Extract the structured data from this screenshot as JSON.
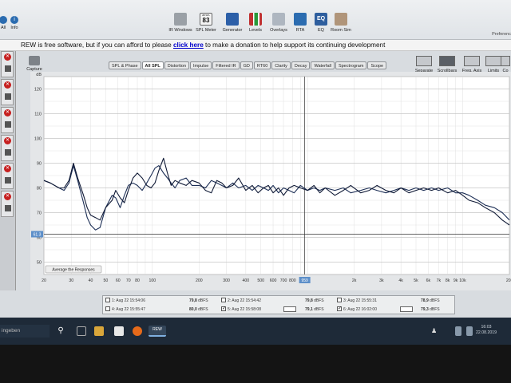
{
  "app": {
    "banner_text": "REW is free software, but if you can afford to please ",
    "banner_link": "click here",
    "banner_tail": " to make a donation to help support its continuing development"
  },
  "toolbar": {
    "left_items": [
      "All",
      "Info"
    ],
    "buttons": [
      {
        "label": "IR Windows",
        "icon": "ir-windows-icon",
        "color": "#8a8f95"
      },
      {
        "label": "SPL Meter",
        "icon": "spl-meter-icon",
        "value": "83",
        "unit": "dB SPL",
        "color": "#4a4f56"
      },
      {
        "label": "Generator",
        "icon": "generator-icon",
        "color": "#2c5fa8"
      },
      {
        "label": "Levels",
        "icon": "levels-icon",
        "color": "#c03030"
      },
      {
        "label": "Overlays",
        "icon": "overlays-icon",
        "color": "#7b8794"
      },
      {
        "label": "RTA",
        "icon": "rta-icon",
        "color": "#2b6cb0"
      },
      {
        "label": "EQ",
        "icon": "eq-icon",
        "color": "#2e5e9e"
      },
      {
        "label": "Room Sim",
        "icon": "room-sim-icon",
        "color": "#8a6f55"
      }
    ],
    "preferences_label": "Preferenc"
  },
  "capture_label": "Capture",
  "tabs": [
    "SPL & Phase",
    "All SPL",
    "Distortion",
    "Impulse",
    "Filtered IR",
    "GD",
    "RT60",
    "Clarity",
    "Decay",
    "Waterfall",
    "Spectrogram",
    "Scope"
  ],
  "active_tab": "All SPL",
  "right_controls": [
    "Separate",
    "Scrollbars",
    "Freq. Axis",
    "Limits",
    "Co"
  ],
  "graph": {
    "ylabel": "dB",
    "cursor_y_label": "61.3",
    "cursor_x_label": "959",
    "average_button": "Average the Responses"
  },
  "chart_data": {
    "type": "line",
    "xscale": "log",
    "xlim": [
      20,
      20000
    ],
    "ylim": [
      45,
      125
    ],
    "yticks": [
      50,
      60,
      70,
      80,
      90,
      100,
      110,
      120
    ],
    "xtick_labels": [
      "20",
      "30",
      "40",
      "50",
      "60",
      "70",
      "80",
      "100",
      "200",
      "300",
      "400",
      "500",
      "600",
      "700",
      "800",
      "1k",
      "2k",
      "3k",
      "4k",
      "5k",
      "6k",
      "7k",
      "8k",
      "9k",
      "10k",
      "20k"
    ],
    "xtick_values": [
      20,
      30,
      40,
      50,
      60,
      70,
      80,
      100,
      200,
      300,
      400,
      500,
      600,
      700,
      800,
      1000,
      2000,
      3000,
      4000,
      5000,
      6000,
      7000,
      8000,
      9000,
      10000,
      20000
    ],
    "cursor": {
      "x": 959,
      "y": 61.3
    },
    "grid": true,
    "series": [
      {
        "x": [
          20,
          22,
          25,
          27,
          29,
          31,
          33,
          36,
          38,
          40,
          43,
          46,
          50,
          55,
          58,
          62,
          66,
          70,
          75,
          80,
          86,
          92,
          98,
          104,
          110,
          118,
          125,
          132,
          140,
          150,
          165,
          180,
          200,
          220,
          240,
          260,
          280,
          300,
          330,
          360,
          400,
          440,
          480,
          520,
          560,
          600,
          650,
          700,
          760,
          820,
          900,
          1000,
          1100,
          1200,
          1300,
          1500,
          1700,
          1900,
          2200,
          2500,
          2800,
          3200,
          3600,
          4000,
          4500,
          5000,
          5600,
          6300,
          7000,
          8000,
          9000,
          10000,
          11000,
          12500,
          14000,
          16000,
          18000,
          20000
        ],
        "y": [
          83,
          82,
          80,
          79,
          82,
          89,
          83,
          74,
          68,
          65,
          63,
          64,
          72,
          77,
          76,
          72,
          77,
          81,
          82,
          81,
          79,
          82,
          85,
          88,
          89,
          86,
          84,
          82,
          80,
          83,
          84,
          81,
          81,
          80,
          83,
          82,
          81,
          80,
          82,
          80,
          81,
          79,
          81,
          80,
          79,
          81,
          78,
          80,
          79,
          78,
          81,
          79,
          80,
          79,
          80,
          79,
          80,
          78,
          79,
          80,
          79,
          78,
          79,
          80,
          79,
          80,
          79,
          80,
          79,
          80,
          78,
          78,
          77,
          75,
          73,
          72,
          70,
          67
        ]
      },
      {
        "x": [
          20,
          22,
          25,
          27,
          29,
          31,
          33,
          36,
          38,
          40,
          43,
          46,
          50,
          55,
          58,
          62,
          66,
          70,
          75,
          80,
          86,
          92,
          98,
          104,
          110,
          118,
          125,
          132,
          140,
          150,
          165,
          180,
          200,
          220,
          240,
          260,
          280,
          300,
          330,
          360,
          400,
          440,
          480,
          520,
          560,
          600,
          650,
          700,
          760,
          820,
          900,
          1000,
          1100,
          1200,
          1300,
          1500,
          1700,
          1900,
          2200,
          2500,
          2800,
          3200,
          3600,
          4000,
          4500,
          5000,
          5600,
          6300,
          7000,
          8000,
          9000,
          10000,
          11000,
          12500,
          14000,
          16000,
          18000,
          20000
        ],
        "y": [
          83,
          82,
          80,
          80,
          83,
          90,
          84,
          77,
          72,
          69,
          68,
          67,
          72,
          75,
          79,
          76,
          74,
          79,
          84,
          86,
          84,
          81,
          80,
          82,
          87,
          92,
          86,
          81,
          83,
          82,
          81,
          83,
          82,
          79,
          78,
          83,
          82,
          80,
          81,
          84,
          79,
          81,
          78,
          80,
          81,
          78,
          80,
          77,
          80,
          81,
          80,
          79,
          81,
          78,
          80,
          77,
          79,
          81,
          78,
          79,
          81,
          79,
          78,
          80,
          78,
          79,
          80,
          79,
          80,
          78,
          79,
          77,
          75,
          74,
          72,
          70,
          67,
          65
        ]
      }
    ]
  },
  "legend": {
    "entries": [
      {
        "label": "1: Aug 22 15:54:06",
        "value": "79,8",
        "unit": "dBFS",
        "checked": false
      },
      {
        "label": "2: Aug 22 15:54:42",
        "value": "79,8",
        "unit": "dBFS",
        "checked": false
      },
      {
        "label": "3: Aug 22 15:55:31",
        "value": "78,9",
        "unit": "dBFS",
        "checked": false
      },
      {
        "label": "4: Aug 22 15:55:47",
        "value": "80,0",
        "unit": "dBFS",
        "checked": false
      },
      {
        "label": "5: Aug 22 15:58:08",
        "value": "79,1",
        "unit": "dBFS",
        "checked": true
      },
      {
        "label": "6: Aug 22 16:02:00",
        "value": "79,3",
        "unit": "dBFS",
        "checked": true
      }
    ]
  },
  "taskbar": {
    "search_text": "ingeben",
    "app_label": "REW",
    "time": "16:03",
    "date": "22.08.2019"
  }
}
